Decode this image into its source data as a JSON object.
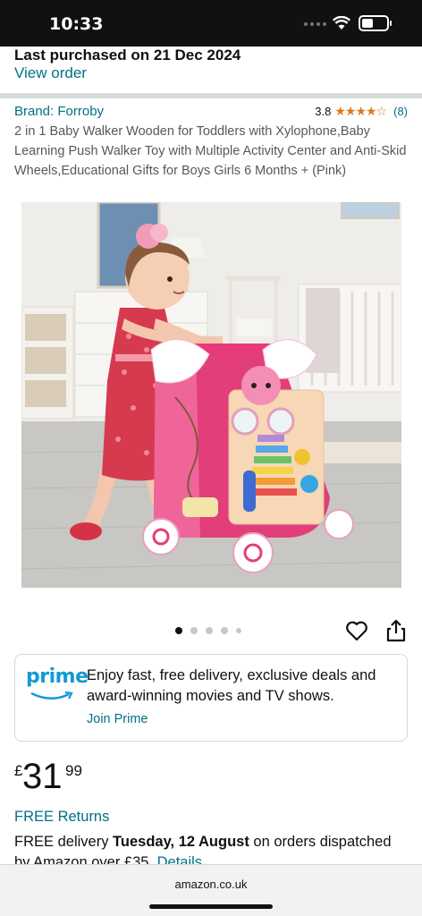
{
  "status_bar": {
    "time": "10:33"
  },
  "purchase": {
    "text": "Last purchased on 21 Dec 2024",
    "view_order": "View order"
  },
  "product": {
    "brand": "Brand: Forroby",
    "rating": "3.8",
    "stars": "★★★★☆",
    "rating_count": "(8)",
    "title": "2 in 1 Baby Walker Wooden for Toddlers with Xylophone,Baby Learning Push Walker Toy with Multiple Activity Center and Anti-Skid Wheels,Educational Gifts for Boys Girls 6 Months + (Pink)"
  },
  "gallery": {
    "image_count": 5,
    "active_index": 0
  },
  "prime": {
    "logo": "prime",
    "text": "Enjoy fast, free delivery, exclusive deals and award-winning movies and TV shows.",
    "join": "Join Prime"
  },
  "price": {
    "symbol": "£",
    "whole": "31",
    "fraction": "99"
  },
  "free_returns": "FREE Returns",
  "delivery": {
    "prefix": "FREE delivery ",
    "date": "Tuesday, 12 August",
    "suffix": " on orders dispatched by Amazon over £35. ",
    "details": "Details"
  },
  "browser": {
    "url": "amazon.co.uk"
  },
  "colors": {
    "link": "#007185",
    "prime_blue": "#1399d6",
    "star": "#de7921",
    "walker_pink": "#e23e7a"
  }
}
